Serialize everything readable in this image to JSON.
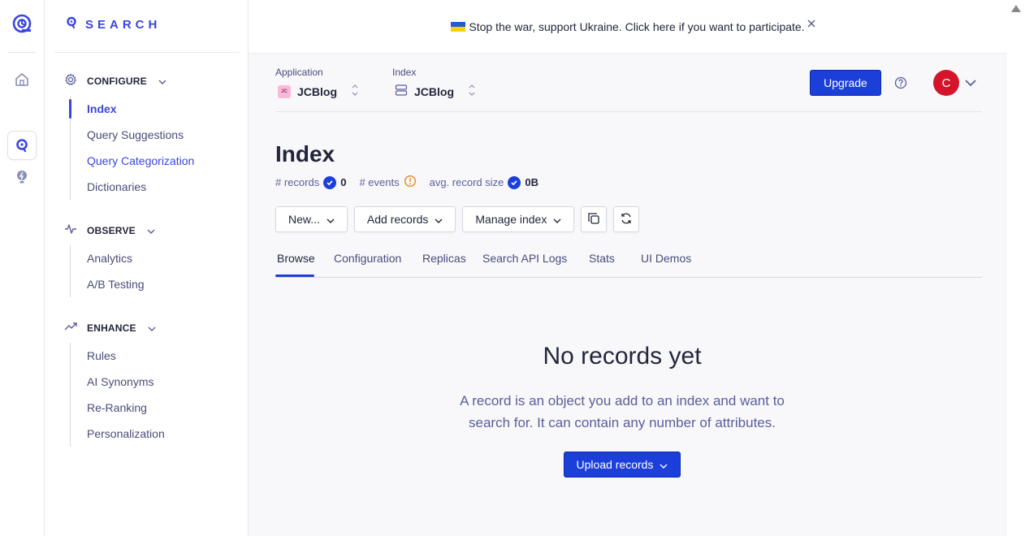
{
  "brand": {
    "title": "SEARCH"
  },
  "sidebar": {
    "sections": [
      {
        "label": "CONFIGURE",
        "items": [
          "Index",
          "Query Suggestions",
          "Query Categorization",
          "Dictionaries"
        ]
      },
      {
        "label": "OBSERVE",
        "items": [
          "Analytics",
          "A/B Testing"
        ]
      },
      {
        "label": "ENHANCE",
        "items": [
          "Rules",
          "AI Synonyms",
          "Re-Ranking",
          "Personalization"
        ]
      }
    ]
  },
  "banner": {
    "text": "Stop the war, support Ukraine. Click here if you want to participate."
  },
  "selectors": {
    "application": {
      "label": "Application",
      "value": "JCBlog",
      "badge": "JC"
    },
    "index": {
      "label": "Index",
      "value": "JCBlog"
    }
  },
  "header": {
    "upgrade_label": "Upgrade",
    "avatar_initial": "C"
  },
  "page": {
    "title": "Index",
    "stats": [
      {
        "label": "# records",
        "value": "0"
      },
      {
        "label": "# events",
        "value": ""
      },
      {
        "label": "avg. record size",
        "value": "0B"
      }
    ]
  },
  "actions": {
    "new": "New...",
    "add_records": "Add records",
    "manage_index": "Manage index"
  },
  "tabs": [
    "Browse",
    "Configuration",
    "Replicas",
    "Search API Logs",
    "Stats",
    "UI Demos"
  ],
  "empty_state": {
    "title": "No records yet",
    "description": "A record is an object you add to an index and want to search for. It can contain any number of attributes.",
    "upload_label": "Upload records"
  },
  "colors": {
    "accent": "#1b3fd8",
    "brand": "#3a46dd",
    "avatar": "#d4142a",
    "warning": "#e8871e"
  }
}
